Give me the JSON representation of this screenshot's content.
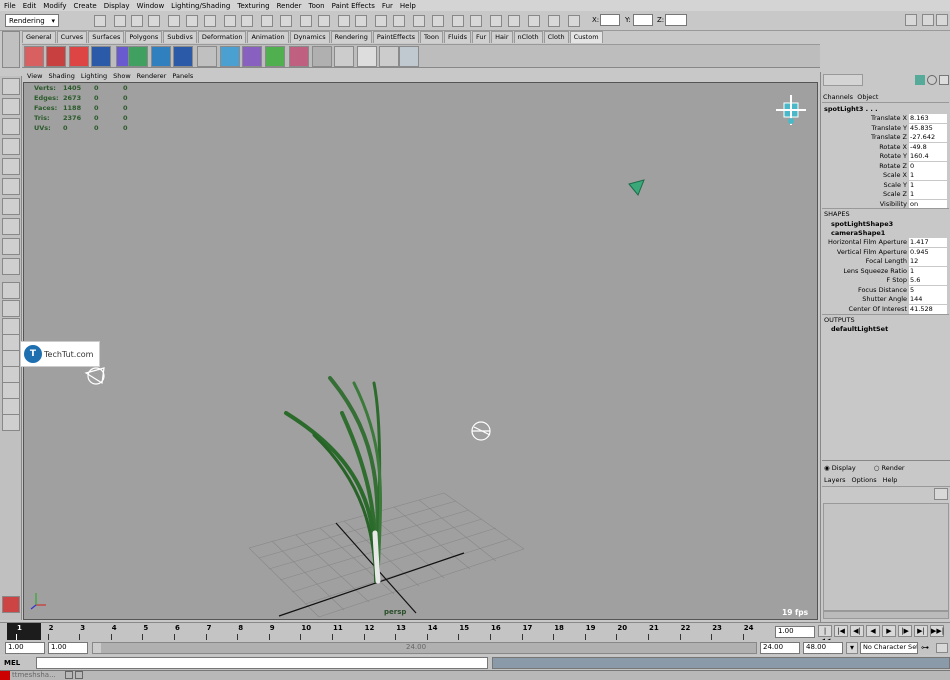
{
  "menubar": [
    "File",
    "Edit",
    "Modify",
    "Create",
    "Display",
    "Window",
    "Lighting/Shading",
    "Texturing",
    "Render",
    "Toon",
    "Paint Effects",
    "Fur",
    "Help"
  ],
  "status": {
    "menu_set": "Rendering",
    "x_label": "X:",
    "y_label": "Y:",
    "z_label": "Z:"
  },
  "shelf_tabs": [
    "General",
    "Curves",
    "Surfaces",
    "Polygons",
    "Subdivs",
    "Deformation",
    "Animation",
    "Dynamics",
    "Rendering",
    "PaintEffects",
    "Toon",
    "Fluids",
    "Fur",
    "Hair",
    "nCloth",
    "Cloth",
    "Custom"
  ],
  "shelf_buttons": [
    "His",
    "CP",
    "FT",
    "All",
    "",
    "FN",
    "VN",
    "All",
    "Cam",
    "",
    "",
    "",
    "",
    "HRB",
    "",
    "mel",
    "",
    "Hshd"
  ],
  "viewport_menu": [
    "View",
    "Shading",
    "Lighting",
    "Show",
    "Renderer",
    "Panels"
  ],
  "hud": [
    {
      "label": "Verts:",
      "v1": "1405",
      "v2": "0",
      "v3": "0"
    },
    {
      "label": "Edges:",
      "v1": "2673",
      "v2": "0",
      "v3": "0"
    },
    {
      "label": "Faces:",
      "v1": "1188",
      "v2": "0",
      "v3": "0"
    },
    {
      "label": "Tris:",
      "v1": "2376",
      "v2": "0",
      "v3": "0"
    },
    {
      "label": "UVs:",
      "v1": "0",
      "v2": "0",
      "v3": "0"
    }
  ],
  "viewport": {
    "camera": "persp",
    "fps": "19 fps",
    "watermark": "TechTut.com"
  },
  "channel_box": {
    "tabs": [
      "Channels",
      "Object"
    ],
    "node": "spotLight3 . . .",
    "transform": [
      {
        "name": "Translate X",
        "value": "8.163"
      },
      {
        "name": "Translate Y",
        "value": "45.835"
      },
      {
        "name": "Translate Z",
        "value": "-27.642"
      },
      {
        "name": "Rotate X",
        "value": "-49.8"
      },
      {
        "name": "Rotate Y",
        "value": "160.4"
      },
      {
        "name": "Rotate Z",
        "value": "0"
      },
      {
        "name": "Scale X",
        "value": "1"
      },
      {
        "name": "Scale Y",
        "value": "1"
      },
      {
        "name": "Scale Z",
        "value": "1"
      },
      {
        "name": "Visibility",
        "value": "on"
      }
    ],
    "shapes_header": "SHAPES",
    "shape1": "spotLightShape3",
    "shape2": "cameraShape1",
    "shape_attrs": [
      {
        "name": "Horizontal Film Aperture",
        "value": "1.417"
      },
      {
        "name": "Vertical Film Aperture",
        "value": "0.945"
      },
      {
        "name": "Focal Length",
        "value": "12"
      },
      {
        "name": "Lens Squeeze Ratio",
        "value": "1"
      },
      {
        "name": "F Stop",
        "value": "5.6"
      },
      {
        "name": "Focus Distance",
        "value": "5"
      },
      {
        "name": "Shutter Angle",
        "value": "144"
      },
      {
        "name": "Center Of Interest",
        "value": "41.528"
      }
    ],
    "outputs_header": "OUTPUTS",
    "output1": "defaultLightSet"
  },
  "layer_panel": {
    "display": "Display",
    "render": "Render",
    "menu": [
      "Layers",
      "Options",
      "Help"
    ]
  },
  "timeline": {
    "ticks": [
      "1",
      "2",
      "3",
      "4",
      "5",
      "6",
      "7",
      "8",
      "9",
      "10",
      "11",
      "12",
      "13",
      "14",
      "15",
      "16",
      "17",
      "18",
      "19",
      "20",
      "21",
      "22",
      "23",
      "24"
    ],
    "current": "1.00"
  },
  "range": {
    "start": "1.00",
    "inner_start": "1.00",
    "handle": "24.00",
    "end": "24.00",
    "end2": "48.00",
    "char_set": "No Character Set"
  },
  "cmd": {
    "label": "MEL"
  },
  "taskbar": {
    "item": "ttmeshsha..."
  }
}
